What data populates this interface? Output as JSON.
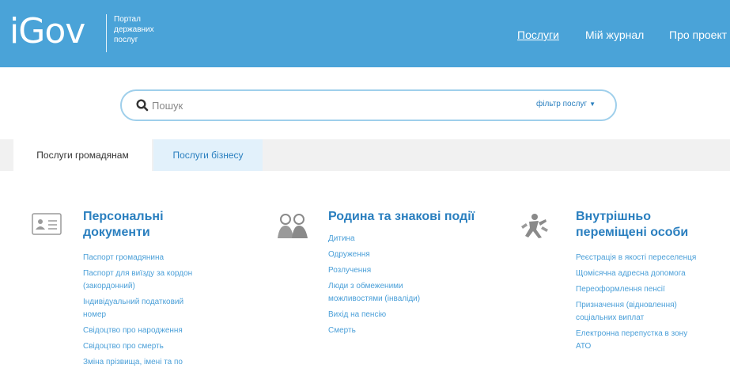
{
  "header": {
    "logo": "iGov",
    "logo_subtitle": "Портал\nдержавних\nпослуг",
    "nav": {
      "services": "Послуги",
      "journal": "Мій журнал",
      "about": "Про проект"
    }
  },
  "search": {
    "placeholder": "Пошук",
    "filter_label": "фільтр послуг"
  },
  "tabs": [
    {
      "label": "Послуги громадянам"
    },
    {
      "label": "Послуги бізнесу"
    }
  ],
  "categories": [
    {
      "icon": "id-card-icon",
      "title": "Персональні\nдокументи",
      "items": [
        "Паспорт громадянина",
        "Паспорт для виїзду за кордон\n(закордонний)",
        "Індивідуальний податковий\nномер",
        "Свідоцтво про народження",
        "Свідоцтво про смерть",
        "Зміна прізвища, імені та по"
      ]
    },
    {
      "icon": "family-icon",
      "title": "Родина та знакові події",
      "items": [
        "Дитина",
        "Одруження",
        "Розлучення",
        "Люди з обмеженими\nможливостями (інваліди)",
        "Вихід на пенсію",
        "Смерть"
      ]
    },
    {
      "icon": "displaced-person-icon",
      "title": "Внутрішньо\nпереміщені особи",
      "items": [
        "Реєстрація в якості переселенця",
        "Щомісячна адресна допомога",
        "Переоформлення пенсії",
        "Призначення (відновлення)\nсоціальних виплат",
        "Електронна перепустка в зону\nАТО"
      ]
    }
  ],
  "colors": {
    "header_bg": "#4aa3d8",
    "accent": "#2a7fbf",
    "link": "#4a9fd8"
  }
}
